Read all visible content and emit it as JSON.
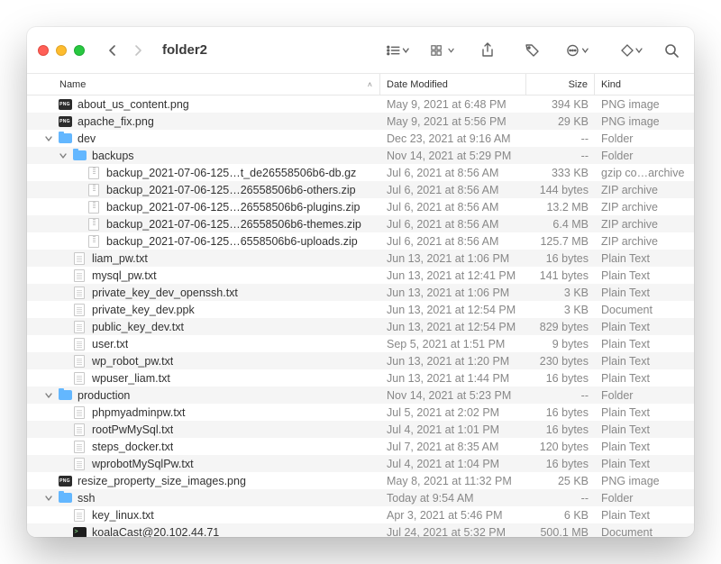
{
  "window": {
    "title": "folder2"
  },
  "columns": {
    "name": "Name",
    "date": "Date Modified",
    "size": "Size",
    "kind": "Kind"
  },
  "rows": [
    {
      "depth": 0,
      "disc": "",
      "icon": "png",
      "name": "about_us_content.png",
      "date": "May 9, 2021 at 6:48 PM",
      "size": "394 KB",
      "kind": "PNG image"
    },
    {
      "depth": 0,
      "disc": "",
      "icon": "png",
      "name": "apache_fix.png",
      "date": "May 9, 2021 at 5:56 PM",
      "size": "29 KB",
      "kind": "PNG image"
    },
    {
      "depth": 0,
      "disc": "v",
      "icon": "folder",
      "name": "dev",
      "date": "Dec 23, 2021 at 9:16 AM",
      "size": "--",
      "kind": "Folder"
    },
    {
      "depth": 1,
      "disc": "v",
      "icon": "folder",
      "name": "backups",
      "date": "Nov 14, 2021 at 5:29 PM",
      "size": "--",
      "kind": "Folder"
    },
    {
      "depth": 2,
      "disc": "",
      "icon": "zip",
      "name": "backup_2021-07-06-125…t_de26558506b6-db.gz",
      "date": "Jul 6, 2021 at 8:56 AM",
      "size": "333 KB",
      "kind": "gzip co…archive"
    },
    {
      "depth": 2,
      "disc": "",
      "icon": "zip",
      "name": "backup_2021-07-06-125…26558506b6-others.zip",
      "date": "Jul 6, 2021 at 8:56 AM",
      "size": "144 bytes",
      "kind": "ZIP archive"
    },
    {
      "depth": 2,
      "disc": "",
      "icon": "zip",
      "name": "backup_2021-07-06-125…26558506b6-plugins.zip",
      "date": "Jul 6, 2021 at 8:56 AM",
      "size": "13.2 MB",
      "kind": "ZIP archive"
    },
    {
      "depth": 2,
      "disc": "",
      "icon": "zip",
      "name": "backup_2021-07-06-125…26558506b6-themes.zip",
      "date": "Jul 6, 2021 at 8:56 AM",
      "size": "6.4 MB",
      "kind": "ZIP archive"
    },
    {
      "depth": 2,
      "disc": "",
      "icon": "zip",
      "name": "backup_2021-07-06-125…6558506b6-uploads.zip",
      "date": "Jul 6, 2021 at 8:56 AM",
      "size": "125.7 MB",
      "kind": "ZIP archive"
    },
    {
      "depth": 1,
      "disc": "",
      "icon": "page",
      "name": "liam_pw.txt",
      "date": "Jun 13, 2021 at 1:06 PM",
      "size": "16 bytes",
      "kind": "Plain Text"
    },
    {
      "depth": 1,
      "disc": "",
      "icon": "page",
      "name": "mysql_pw.txt",
      "date": "Jun 13, 2021 at 12:41 PM",
      "size": "141 bytes",
      "kind": "Plain Text"
    },
    {
      "depth": 1,
      "disc": "",
      "icon": "page",
      "name": "private_key_dev_openssh.txt",
      "date": "Jun 13, 2021 at 1:06 PM",
      "size": "3 KB",
      "kind": "Plain Text"
    },
    {
      "depth": 1,
      "disc": "",
      "icon": "page",
      "name": "private_key_dev.ppk",
      "date": "Jun 13, 2021 at 12:54 PM",
      "size": "3 KB",
      "kind": "Document"
    },
    {
      "depth": 1,
      "disc": "",
      "icon": "page",
      "name": "public_key_dev.txt",
      "date": "Jun 13, 2021 at 12:54 PM",
      "size": "829 bytes",
      "kind": "Plain Text"
    },
    {
      "depth": 1,
      "disc": "",
      "icon": "page",
      "name": "user.txt",
      "date": "Sep 5, 2021 at 1:51 PM",
      "size": "9 bytes",
      "kind": "Plain Text"
    },
    {
      "depth": 1,
      "disc": "",
      "icon": "page",
      "name": "wp_robot_pw.txt",
      "date": "Jun 13, 2021 at 1:20 PM",
      "size": "230 bytes",
      "kind": "Plain Text"
    },
    {
      "depth": 1,
      "disc": "",
      "icon": "page",
      "name": "wpuser_liam.txt",
      "date": "Jun 13, 2021 at 1:44 PM",
      "size": "16 bytes",
      "kind": "Plain Text"
    },
    {
      "depth": 0,
      "disc": "v",
      "icon": "folder",
      "name": "production",
      "date": "Nov 14, 2021 at 5:23 PM",
      "size": "--",
      "kind": "Folder"
    },
    {
      "depth": 1,
      "disc": "",
      "icon": "page",
      "name": "phpmyadminpw.txt",
      "date": "Jul 5, 2021 at 2:02 PM",
      "size": "16 bytes",
      "kind": "Plain Text"
    },
    {
      "depth": 1,
      "disc": "",
      "icon": "page",
      "name": "rootPwMySql.txt",
      "date": "Jul 4, 2021 at 1:01 PM",
      "size": "16 bytes",
      "kind": "Plain Text"
    },
    {
      "depth": 1,
      "disc": "",
      "icon": "page",
      "name": "steps_docker.txt",
      "date": "Jul 7, 2021 at 8:35 AM",
      "size": "120 bytes",
      "kind": "Plain Text"
    },
    {
      "depth": 1,
      "disc": "",
      "icon": "page",
      "name": "wprobotMySqlPw.txt",
      "date": "Jul 4, 2021 at 1:04 PM",
      "size": "16 bytes",
      "kind": "Plain Text"
    },
    {
      "depth": 0,
      "disc": "",
      "icon": "png",
      "name": "resize_property_size_images.png",
      "date": "May 8, 2021 at 11:32 PM",
      "size": "25 KB",
      "kind": "PNG image"
    },
    {
      "depth": 0,
      "disc": "v",
      "icon": "folder",
      "name": "ssh",
      "date": "Today at 9:54 AM",
      "size": "--",
      "kind": "Folder"
    },
    {
      "depth": 1,
      "disc": "",
      "icon": "page",
      "name": "key_linux.txt",
      "date": "Apr 3, 2021 at 5:46 PM",
      "size": "6 KB",
      "kind": "Plain Text"
    },
    {
      "depth": 1,
      "disc": "",
      "icon": "term",
      "name": "koalaCast@20.102.44.71",
      "date": "Jul 24, 2021 at 5:32 PM",
      "size": "500.1 MB",
      "kind": "Document"
    }
  ]
}
